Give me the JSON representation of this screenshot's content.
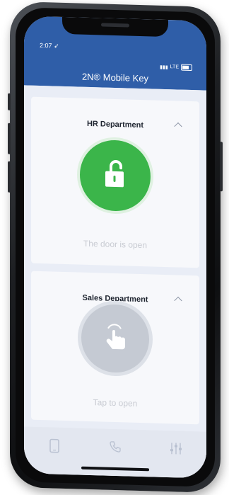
{
  "status_bar": {
    "time": "2:07",
    "network": "LTE"
  },
  "app": {
    "title": "2N® Mobile Key"
  },
  "cards": [
    {
      "title": "HR Department",
      "status": "The door is open"
    },
    {
      "title": "Sales Department",
      "status": "Tap to open"
    }
  ],
  "nav": [
    {
      "icon": "phone-icon"
    },
    {
      "icon": "call-icon"
    },
    {
      "icon": "settings-sliders-icon"
    }
  ],
  "colors": {
    "header": "#2f5ea8",
    "open": "#3bb54a",
    "idle": "#c5cad3"
  }
}
